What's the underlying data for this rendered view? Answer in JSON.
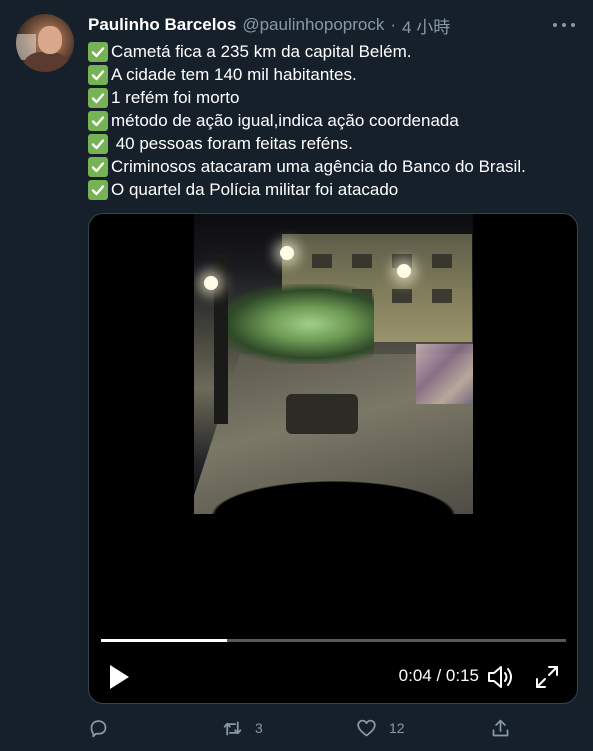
{
  "tweet": {
    "author_name": "Paulinho Barcelos",
    "author_handle": "@paulinhopoprock",
    "separator": "·",
    "time_ago": "4 小時",
    "lines": [
      {
        "emoji": "check-mark-button",
        "text": "Cametá fica a 235 km da capital Belém."
      },
      {
        "emoji": "check-mark-button",
        "text": "A cidade tem 140 mil habitantes."
      },
      {
        "emoji": "check-mark-button",
        "text": "1 refém foi morto"
      },
      {
        "emoji": "check-mark-button",
        "text": "método de ação igual,indica ação coordenada"
      },
      {
        "emoji": "check-mark-button",
        "text": " 40 pessoas foram feitas reféns."
      },
      {
        "emoji": "check-mark-button",
        "text": "Criminosos atacaram uma agência do Banco do Brasil."
      },
      {
        "emoji": "check-mark-button",
        "text": "O quartel da Polícia militar foi atacado"
      }
    ]
  },
  "video": {
    "current_time": "0:04",
    "duration": "0:15",
    "time_display": "0:04 / 0:15",
    "progress_fraction": 0.27,
    "controls": {
      "play_icon": "play-icon",
      "volume_icon": "volume-icon",
      "fullscreen_icon": "fullscreen-icon"
    }
  },
  "actions": {
    "reply_icon": "reply-icon",
    "retweet_icon": "retweet-icon",
    "retweet_count": "3",
    "like_icon": "heart-icon",
    "like_count": "12",
    "share_icon": "share-icon"
  },
  "colors": {
    "background": "#15202b",
    "secondary_text": "#8899a6",
    "check_green": "#77b255",
    "media_border": "#38444d"
  }
}
